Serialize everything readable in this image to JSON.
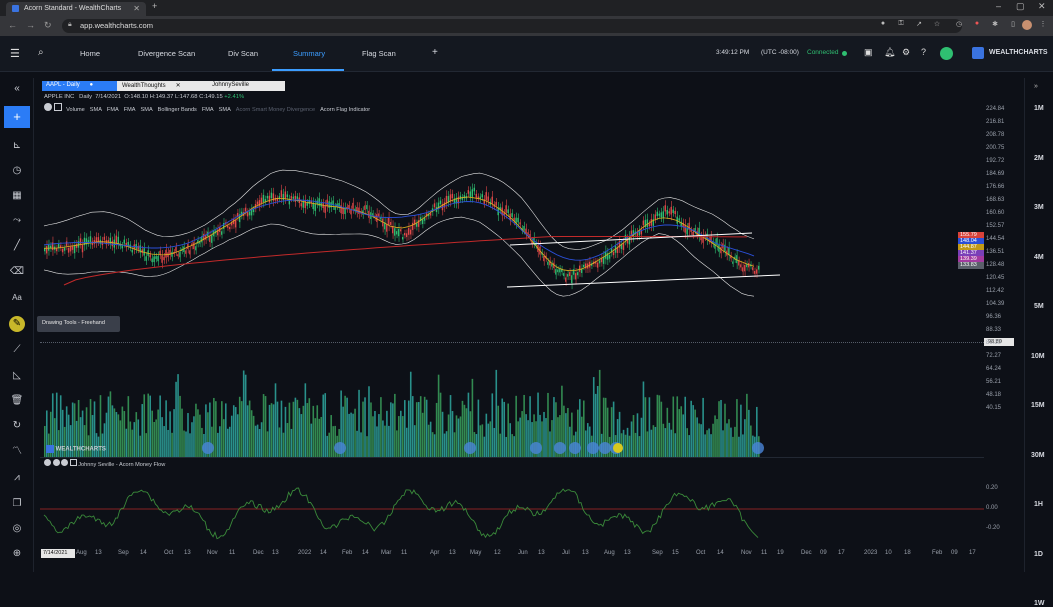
{
  "browser": {
    "tab_title": "Acorn Standard - WealthCharts",
    "url": "app.wealthcharts.com"
  },
  "nav": {
    "items": [
      "Home",
      "Divergence Scan",
      "Div Scan",
      "Summary",
      "Flag Scan"
    ],
    "active": "Summary",
    "add": "+"
  },
  "status": {
    "time": "3:49:12 PM",
    "tz": "(UTC -08:00)",
    "connected": "Connected",
    "brand": "WEALTHCHARTS"
  },
  "chart_tabs": {
    "symbol_tab": "AAPL - Daily",
    "tab2": "WealthThoughts",
    "tab3": "JohnnySeville"
  },
  "ohlc": {
    "name": "APPLE INC",
    "interval": "Daily",
    "date": "7/14/2021",
    "o": "O:148.10",
    "h": "H:149.37",
    "l": "L:147.68",
    "c": "C:149.15",
    "chg": "+2.41%"
  },
  "indicators": [
    "Volume",
    "SMA",
    "FMA",
    "FMA",
    "SMA",
    "Bollinger Bands",
    "FMA",
    "SMA",
    "Acorn Smart Money Divergence",
    "Acorn Flag Indicator"
  ],
  "tooltip": "Drawing Tools - Freehand",
  "sub_indicator": "Johnny Seville - Acorn Money Flow",
  "watermark": "WEALTHCHARTS",
  "timeframes": [
    "1M",
    "2M",
    "3M",
    "4M",
    "5M",
    "10M",
    "15M",
    "30M",
    "1H",
    "1D",
    "1W"
  ],
  "price_axis": [
    "224.84",
    "216.81",
    "208.78",
    "200.75",
    "192.72",
    "184.69",
    "176.66",
    "168.63",
    "160.60",
    "152.57",
    "144.54",
    "136.51",
    "128.48",
    "120.45",
    "112.42",
    "104.39",
    "96.36",
    "88.33",
    "80.30",
    "72.27",
    "64.24",
    "56.21",
    "48.18",
    "40.15"
  ],
  "price_badges": [
    {
      "v": "155.79",
      "c": "#d9423a"
    },
    {
      "v": "148.04",
      "c": "#2b4fd8"
    },
    {
      "v": "144.87",
      "c": "#c29a17"
    },
    {
      "v": "141.37",
      "c": "#7a3fb8"
    },
    {
      "v": "139.39",
      "c": "#a33aa0"
    },
    {
      "v": "133.83",
      "c": "#5a5f6a"
    }
  ],
  "crosshair_price": "98.80",
  "flow_axis": [
    "0.20",
    "0.00",
    "-0.20"
  ],
  "x_axis": [
    "Aug",
    "13",
    "Sep",
    "14",
    "Oct",
    "13",
    "Nov",
    "11",
    "Dec",
    "13",
    "2022",
    "14",
    "Feb",
    "14",
    "Mar",
    "11",
    "Apr",
    "13",
    "May",
    "12",
    "Jun",
    "13",
    "Jul",
    "13",
    "Aug",
    "13",
    "Sep",
    "15",
    "Oct",
    "14",
    "Nov",
    "11",
    "19",
    "Dec",
    "09",
    "17",
    "2023",
    "10",
    "18",
    "Feb",
    "09",
    "17"
  ],
  "x_cursor": "7/14/2021"
}
